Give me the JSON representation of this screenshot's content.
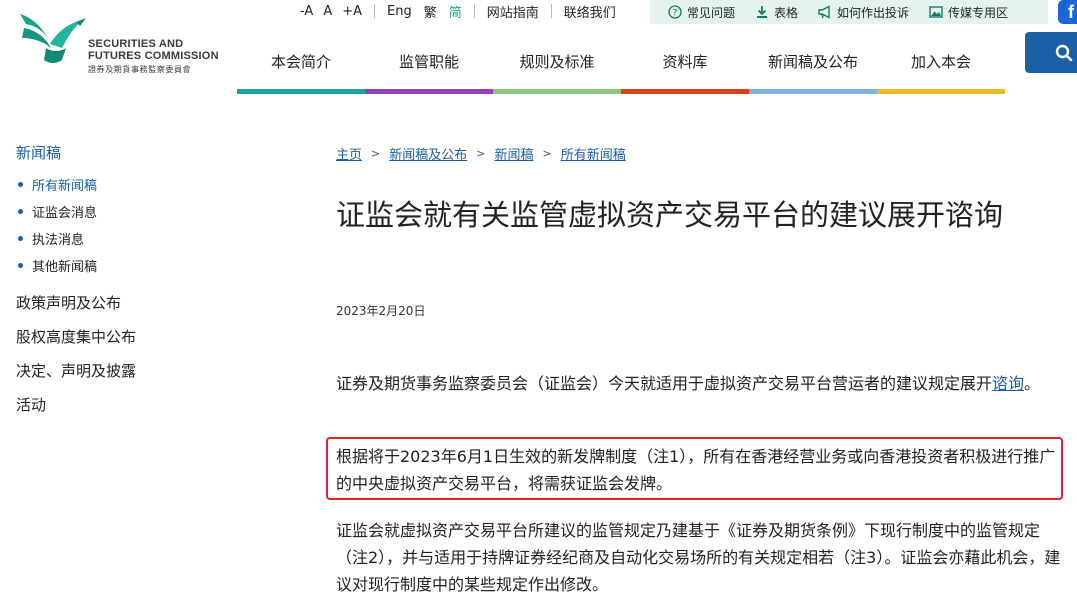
{
  "logo": {
    "line1": "SECURITIES AND",
    "line2": "FUTURES COMMISSION",
    "zh": "證券及期貨事務監察委員會"
  },
  "util": {
    "font_small": "-A",
    "font_mid": "A",
    "font_large": "+A",
    "lang_en": "Eng",
    "lang_tc": "繁",
    "lang_sc": "简",
    "sitemap": "网站指南",
    "contact": "联络我们"
  },
  "quick": {
    "faq": "常见问题",
    "forms": "表格",
    "complaint": "如何作出投诉",
    "media": "传媒专用区"
  },
  "nav": [
    {
      "label": "本会简介",
      "color": "#1aa3a0"
    },
    {
      "label": "监管职能",
      "color": "#9b3fb5"
    },
    {
      "label": "规则及标准",
      "color": "#8cc97e"
    },
    {
      "label": "资料库",
      "color": "#d8411c"
    },
    {
      "label": "新闻稿及公布",
      "color": "#7ab3dc"
    },
    {
      "label": "加入本会",
      "color": "#f2b81f"
    }
  ],
  "sidebar": {
    "heading": "新闻稿",
    "sub": [
      "所有新闻稿",
      "证监会消息",
      "执法消息",
      "其他新闻稿"
    ],
    "main": [
      "政策声明及公布",
      "股权高度集中公布",
      "决定、声明及披露",
      "活动"
    ]
  },
  "breadcrumb": [
    "主页",
    "新闻稿及公布",
    "新闻稿",
    "所有新闻稿"
  ],
  "article": {
    "title": "证监会就有关监管虚拟资产交易平台的建议展开谘询",
    "date": "2023年2月20日",
    "p1_before": "证券及期货事务监察委员会（证监会）今天就适用于虚拟资产交易平台营运者的建议规定展开",
    "p1_link": "谘询",
    "p1_after": "。",
    "p2": "根据将于2023年6月1日生效的新发牌制度（注1），所有在香港经营业务或向香港投资者积极进行推广的中央虚拟资产交易平台，将需获证监会发牌。",
    "p3": "证监会就虚拟资产交易平台所建议的监管规定乃建基于《证券及期货条例》下现行制度中的监管规定（注2），并与适用于持牌证券经纪商及自动化交易场所的有关规定相若（注3）。证监会亦藉此机会，建议对现行制度中的某些规定作出修改。"
  },
  "colors": {
    "brand_teal": "#1aa38a",
    "link_blue": "#1b5fa7",
    "highlight_red": "#e0232a"
  }
}
